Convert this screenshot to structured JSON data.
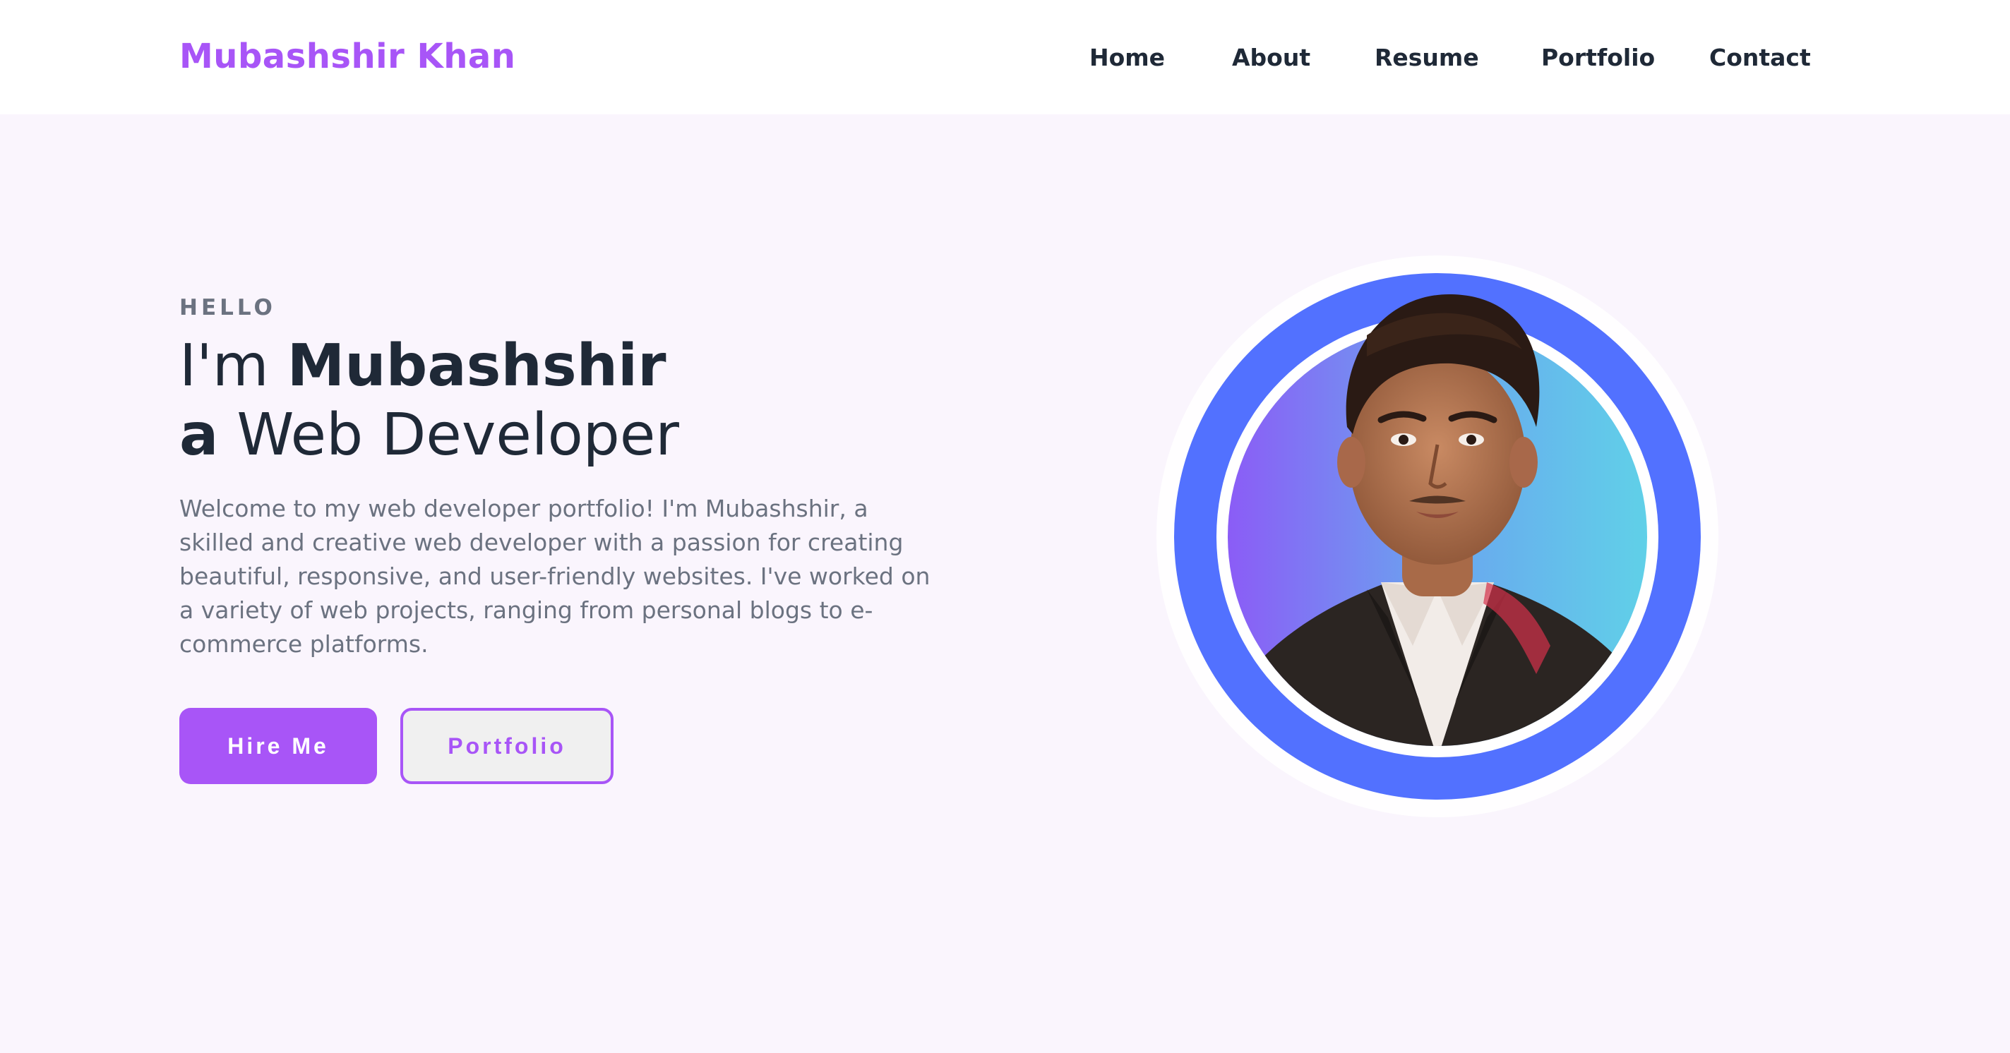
{
  "header": {
    "brand": "Mubashshir Khan",
    "nav": {
      "home": "Home",
      "about": "About",
      "resume": "Resume",
      "portfolio": "Portfolio",
      "contact": "Contact"
    }
  },
  "hero": {
    "eyebrow": "HELLO",
    "line1_prefix": "I'm ",
    "line1_name": "Mubashshir",
    "line2_prefix": "a",
    "line2_role": " Web Developer",
    "intro": "Welcome to my web developer portfolio! I'm Mubashshir, a skilled and creative web developer with a passion for creating beautiful, responsive, and user-friendly websites. I've worked on a variety of web projects, ranging from personal blogs to e-commerce platforms.",
    "buttons": {
      "hire": "Hire Me",
      "portfolio": "Portfolio"
    }
  },
  "colors": {
    "accent": "#a855f7",
    "ring": "#5271ff",
    "background": "#faf5fd"
  },
  "icons": {
    "avatar": "profile-photo"
  }
}
